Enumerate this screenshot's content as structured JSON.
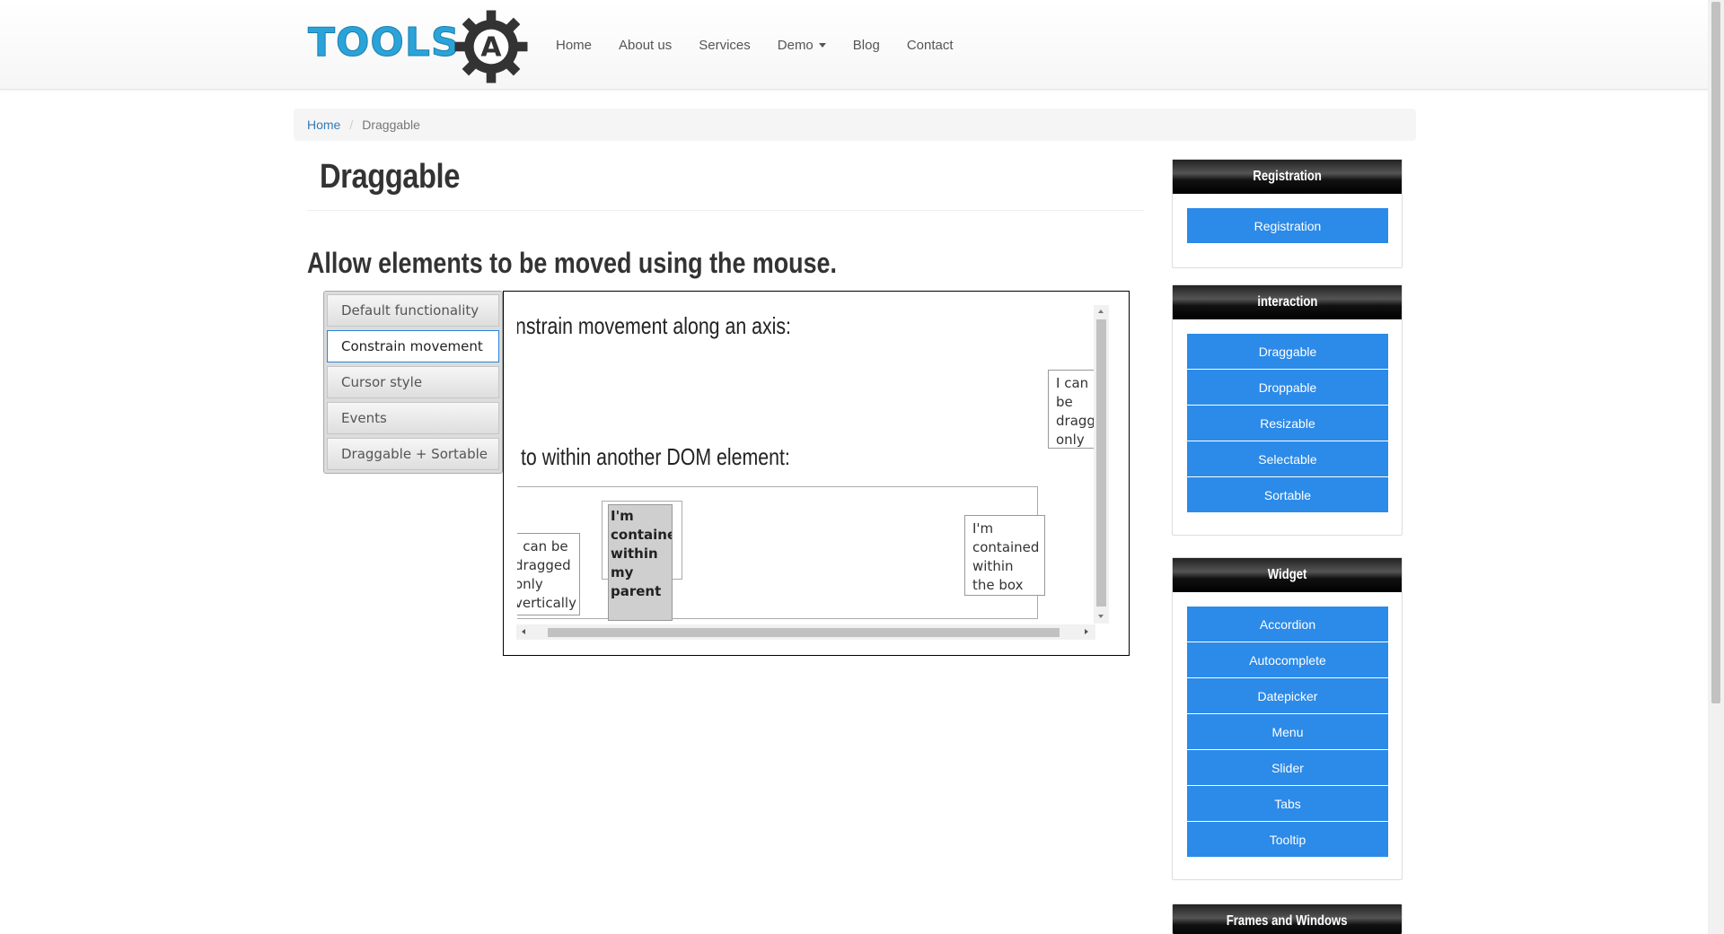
{
  "logo": {
    "text": "TOOLS",
    "letter": "A"
  },
  "nav": {
    "items": [
      {
        "label": "Home"
      },
      {
        "label": "About us"
      },
      {
        "label": "Services"
      },
      {
        "label": "Demo"
      },
      {
        "label": "Blog"
      },
      {
        "label": "Contact"
      }
    ]
  },
  "breadcrumb": {
    "home": "Home",
    "separator": "/",
    "current": "Draggable"
  },
  "main": {
    "title": "Draggable",
    "subtitle": "Allow elements to be moved using the mouse."
  },
  "demo_tabs": [
    {
      "label": "Default functionality",
      "active": false
    },
    {
      "label": "Constrain movement",
      "active": true
    },
    {
      "label": "Cursor style",
      "active": false
    },
    {
      "label": "Events",
      "active": false
    },
    {
      "label": "Draggable + Sortable",
      "active": false
    }
  ],
  "frame": {
    "heading_axis": "nstrain movement along an axis:",
    "heading_dom": "to within another DOM element:",
    "horizontal_box": "I can be dragged only horizontally",
    "vertical_box": "I can be dragged only vertically",
    "contained_parent": "I'm contained within my parent",
    "contained_box": "I'm contained within the box"
  },
  "sidebar": {
    "panels": [
      {
        "title": "Registration",
        "items": [
          "Registration"
        ]
      },
      {
        "title": "interaction",
        "items": [
          "Draggable",
          "Droppable",
          "Resizable",
          "Selectable",
          "Sortable"
        ]
      },
      {
        "title": "Widget",
        "items": [
          "Accordion",
          "Autocomplete",
          "Datepicker",
          "Menu",
          "Slider",
          "Tabs",
          "Tooltip"
        ]
      },
      {
        "title": "Frames and Windows",
        "items": []
      }
    ]
  },
  "colors": {
    "accent": "#2c8ae8",
    "logo": "#2aa3d8",
    "link": "#337ab7"
  }
}
